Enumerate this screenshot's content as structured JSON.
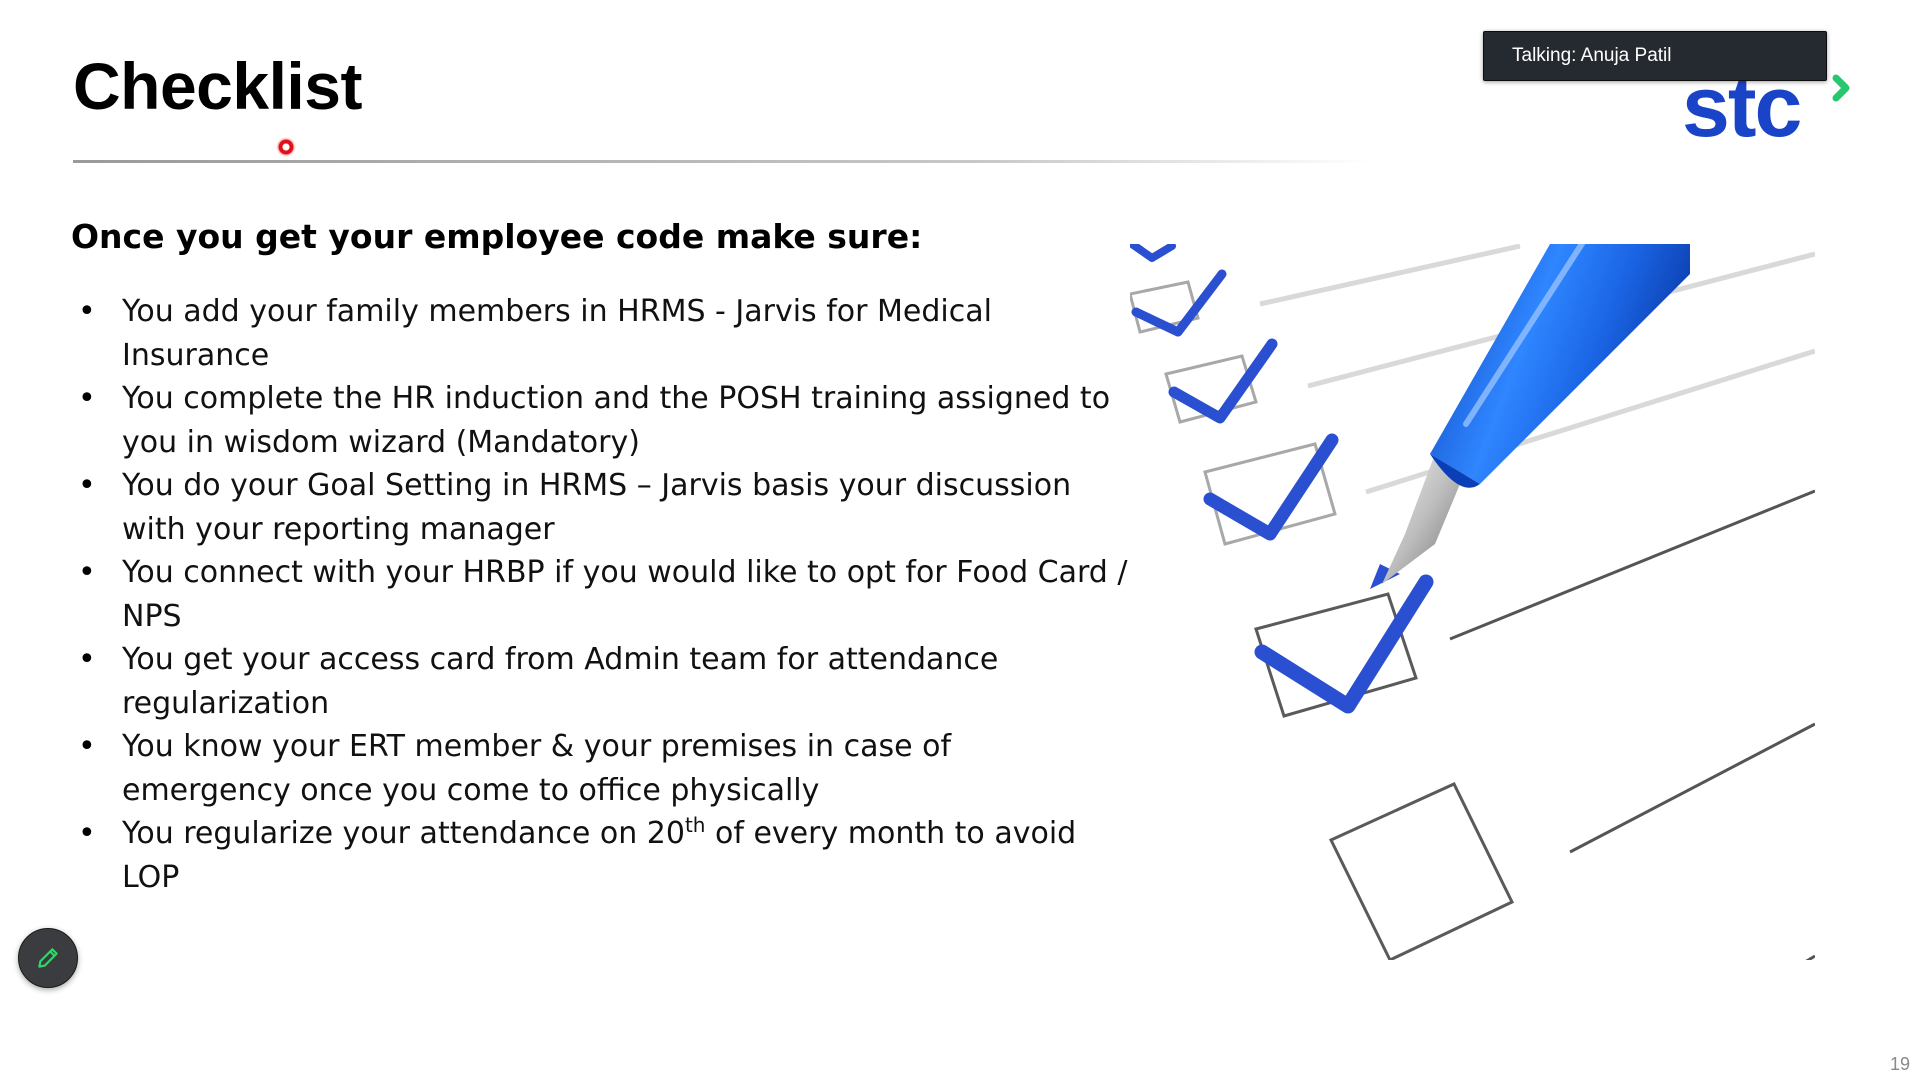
{
  "slide": {
    "title": "Checklist",
    "subheading": "Once you get your employee code make sure:",
    "items": [
      {
        "text": "You add your family members in HRMS - Jarvis for Medical Insurance"
      },
      {
        "text": "You complete the HR induction and the POSH training assigned to you in wisdom wizard (Mandatory)"
      },
      {
        "text": "You do your Goal Setting in HRMS – Jarvis basis your discussion with your reporting manager"
      },
      {
        "text": "You connect with your HRBP if you would like to opt for Food Card / NPS"
      },
      {
        "text": "You get your access card from Admin team for attendance regularization"
      },
      {
        "text": "You know your ERT member & your premises in case of emergency once you come to office physically"
      },
      {
        "text_before": "You regularize your attendance on 20",
        "superscript": "th",
        "text_after": " of every month to avoid LOP"
      }
    ],
    "page_number": "19"
  },
  "meeting": {
    "talking_label": "Talking: Anuja Patil"
  },
  "icons": {
    "bullet": "•",
    "pen": "pen-icon",
    "logo": "stc-logo",
    "image": "checklist-pen-image"
  },
  "colors": {
    "logo_blue": "#1a44c8",
    "logo_green": "#28c76f",
    "check_blue": "#2a4fd0",
    "pen_blue": "#1d6fe0",
    "badge_bg": "#252a30",
    "pen_button_bg": "#3a3c3f",
    "pen_icon_green": "#35d46a",
    "laser_red": "#e0101a"
  }
}
